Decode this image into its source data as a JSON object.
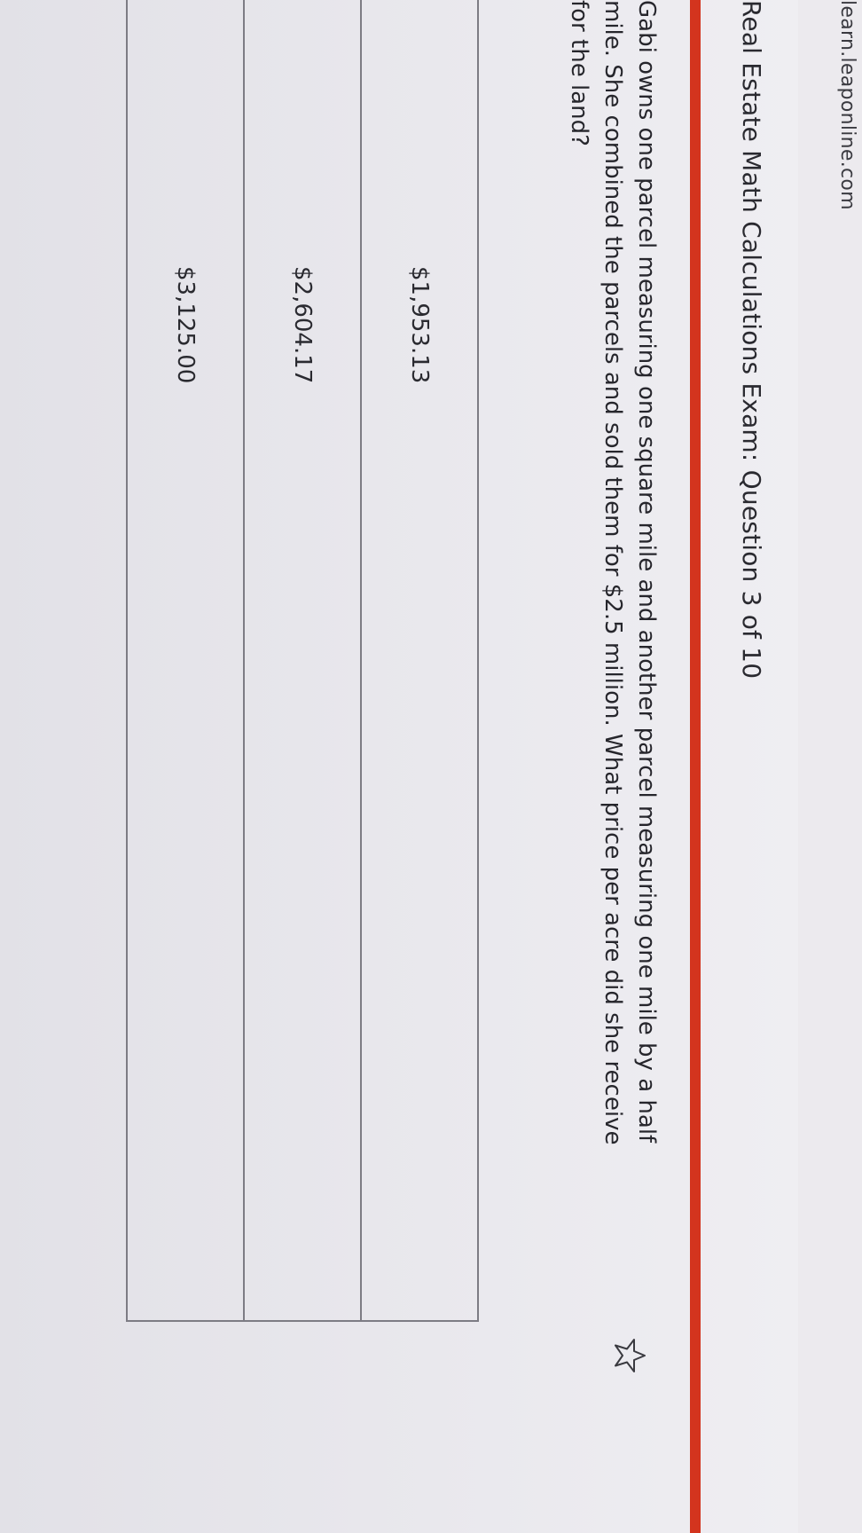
{
  "browser": {
    "url": "learn.leaponline.com"
  },
  "header": {
    "title": "Real Estate Math Calculations Exam: Question 3 of 10"
  },
  "question": {
    "text": "Gabi owns one parcel measuring one square mile and another parcel measuring one mile by a half mile. She combined the parcels and sold them for $2.5 million. What price per acre did she receive for the land?"
  },
  "icons": {
    "favorite": "star-icon"
  },
  "colors": {
    "accent": "#d3341e"
  },
  "answers": [
    {
      "label": "$1,953.13"
    },
    {
      "label": "$2,604.17"
    },
    {
      "label": "$3,125.00"
    }
  ]
}
